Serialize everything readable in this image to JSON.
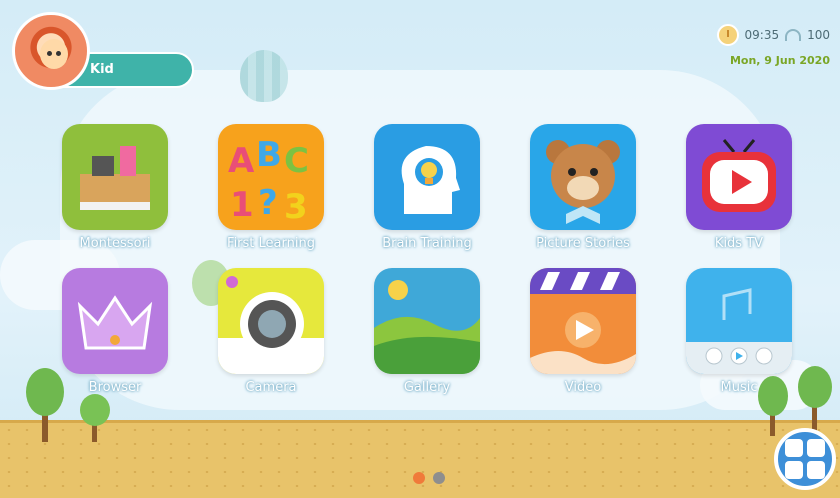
{
  "profile": {
    "name": "Kid"
  },
  "status": {
    "time": "09:35",
    "battery": "100",
    "date": "Mon, 9 Jun 2020"
  },
  "apps": [
    {
      "label": "Montessori",
      "icon": "montessori-icon",
      "color": "#8fbf3c"
    },
    {
      "label": "First Learning",
      "icon": "abc-icon",
      "color": "#f7a21c"
    },
    {
      "label": "Brain Training",
      "icon": "brain-icon",
      "color": "#2a9de3"
    },
    {
      "label": "Picture Stories",
      "icon": "bear-icon",
      "color": "#29a6e8"
    },
    {
      "label": "Kids TV",
      "icon": "tv-icon",
      "color": "#7f4bd4"
    },
    {
      "label": "Browser",
      "icon": "crown-icon",
      "color": "#b77be0"
    },
    {
      "label": "Camera",
      "icon": "camera-icon",
      "color": "#e6e83c"
    },
    {
      "label": "Gallery",
      "icon": "gallery-icon",
      "color": "#3fa8d8"
    },
    {
      "label": "Video",
      "icon": "video-icon",
      "color": "#f28d3a"
    },
    {
      "label": "Music",
      "icon": "music-icon",
      "color": "#3fb2ec"
    }
  ],
  "pager": {
    "active_color": "#f07a3a",
    "inactive_color": "#8e8e8e"
  }
}
